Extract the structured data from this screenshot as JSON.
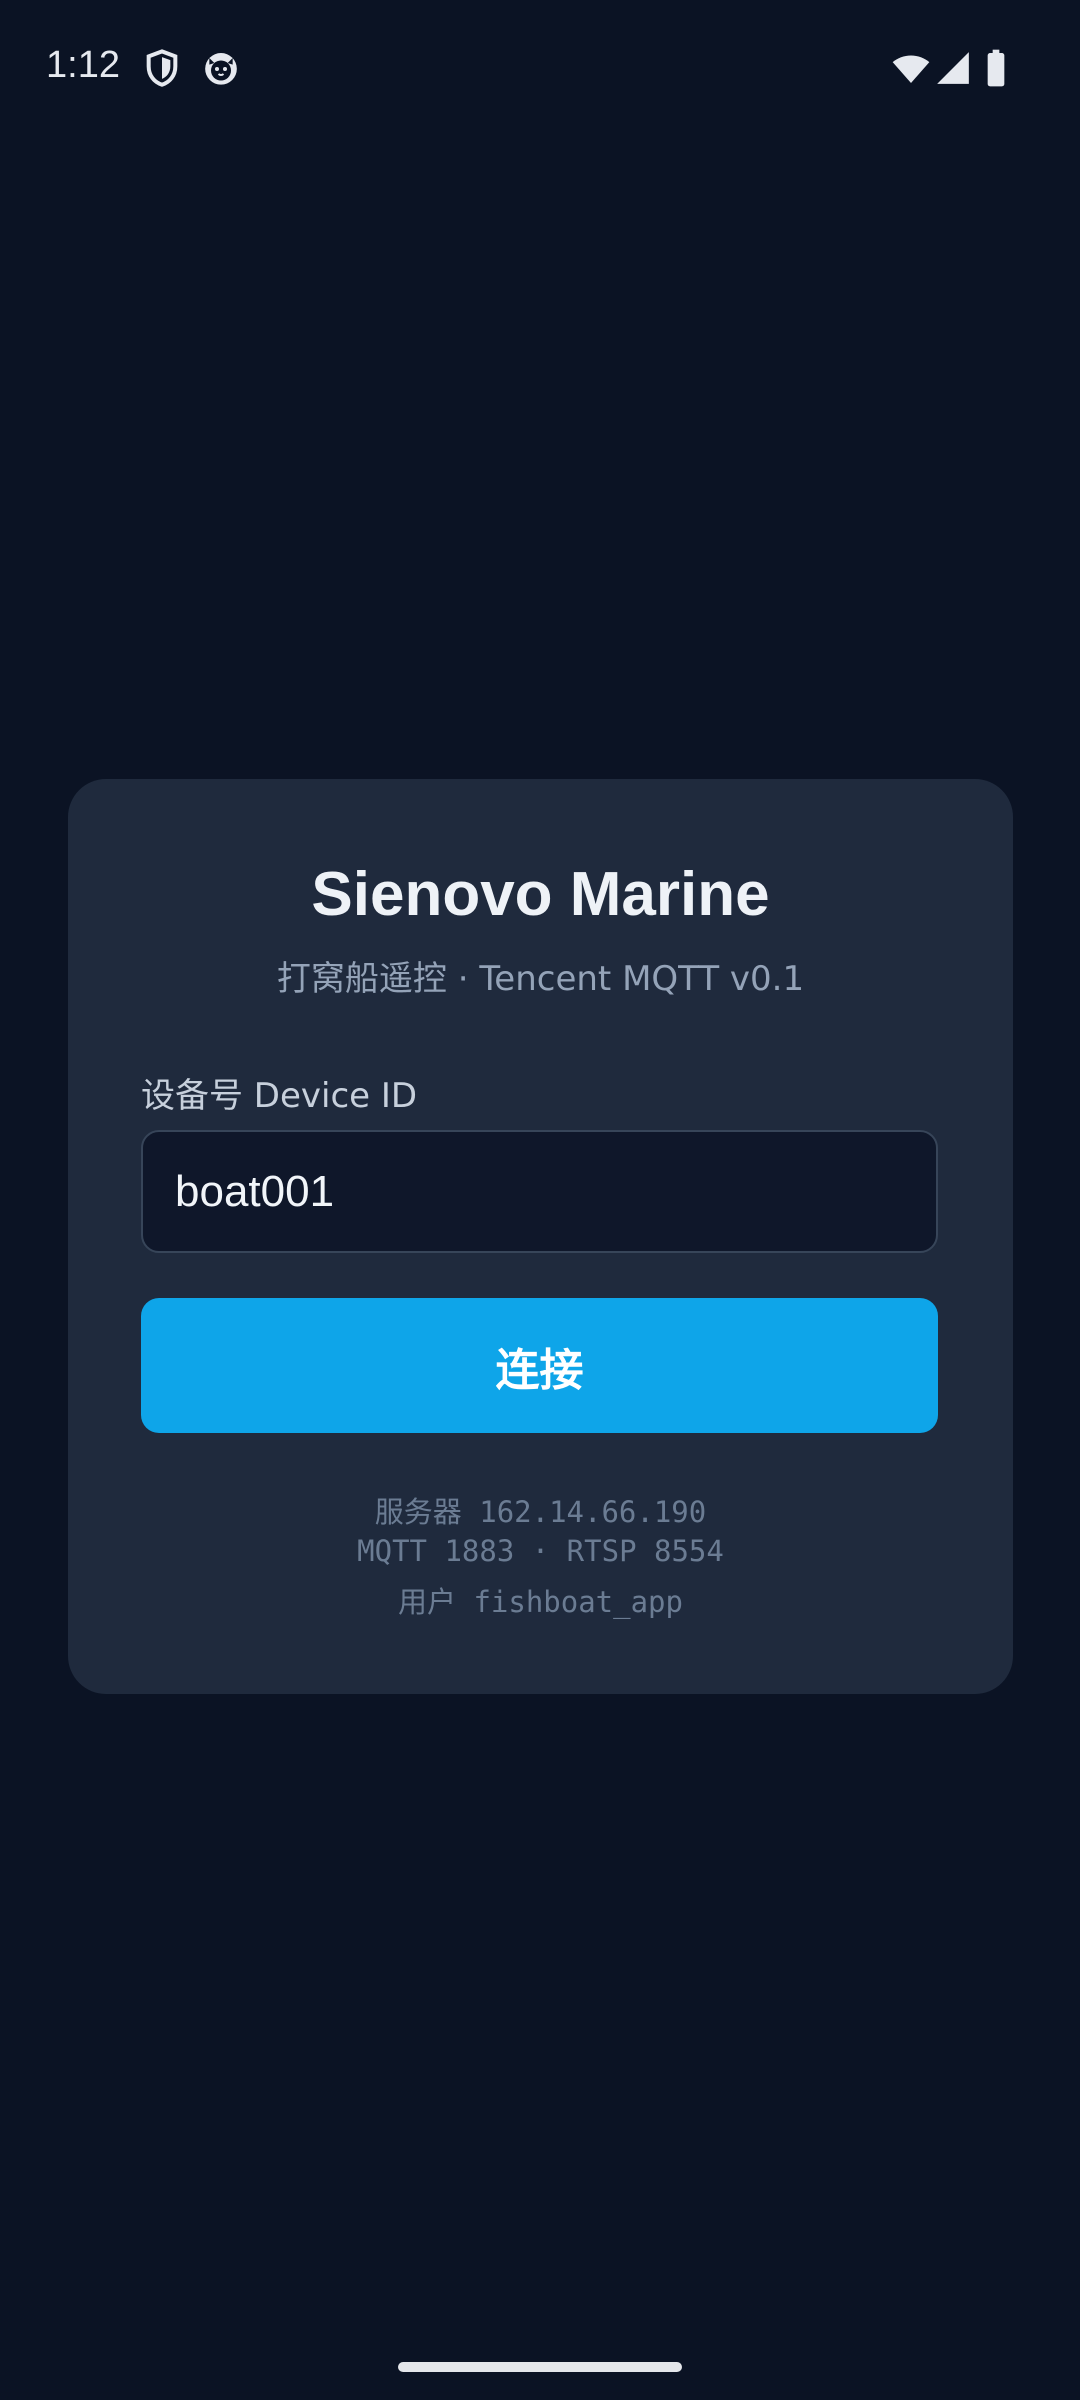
{
  "status_bar": {
    "time": "1:12",
    "icons_left": [
      "shield-icon",
      "cat-face-icon"
    ],
    "icons_right": [
      "wifi-icon",
      "cell-signal-icon",
      "battery-icon"
    ]
  },
  "card": {
    "title": "Sienovo Marine",
    "subtitle": "打窝船遥控 · Tencent MQTT v0.1",
    "device_label": "设备号 Device ID",
    "device_value": "boat001",
    "connect_label": "连接",
    "info": {
      "server": "服务器 162.14.66.190",
      "ports": "MQTT 1883 · RTSP 8554",
      "user": "用户 fishboat_app"
    }
  },
  "colors": {
    "background": "#0b1324",
    "card": "#1f2a3d",
    "accent": "#0ea5e9",
    "input_bg": "#0f172a"
  }
}
